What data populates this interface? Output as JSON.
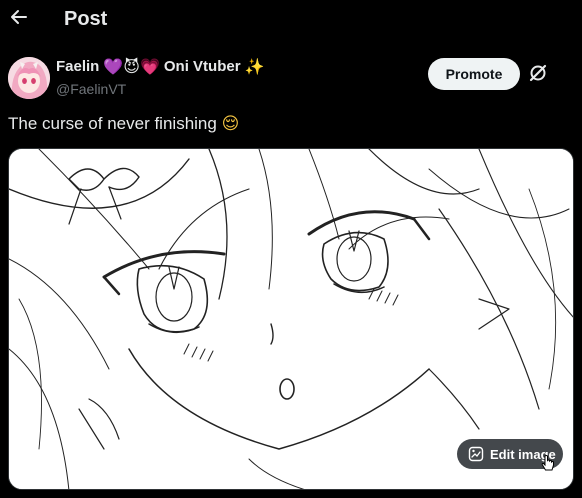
{
  "header": {
    "title": "Post"
  },
  "author": {
    "name": "Faelin",
    "name_emojis": "💜😈💗",
    "title_suffix": "Oni Vtuber",
    "suffix_emoji": "✨",
    "handle": "@FaelinVT",
    "promote_label": "Promote"
  },
  "post": {
    "text": "The curse of never finishing",
    "text_emoji": "😌",
    "media": {
      "edit_label": "Edit image"
    }
  },
  "icons": {
    "back": "back-arrow-icon",
    "grok": "grok-icon",
    "edit": "edit-image-icon"
  },
  "colors": {
    "background": "#000000",
    "text": "#e7e9ea",
    "secondary_text": "#71767b",
    "promote_bg": "#eff3f4"
  }
}
